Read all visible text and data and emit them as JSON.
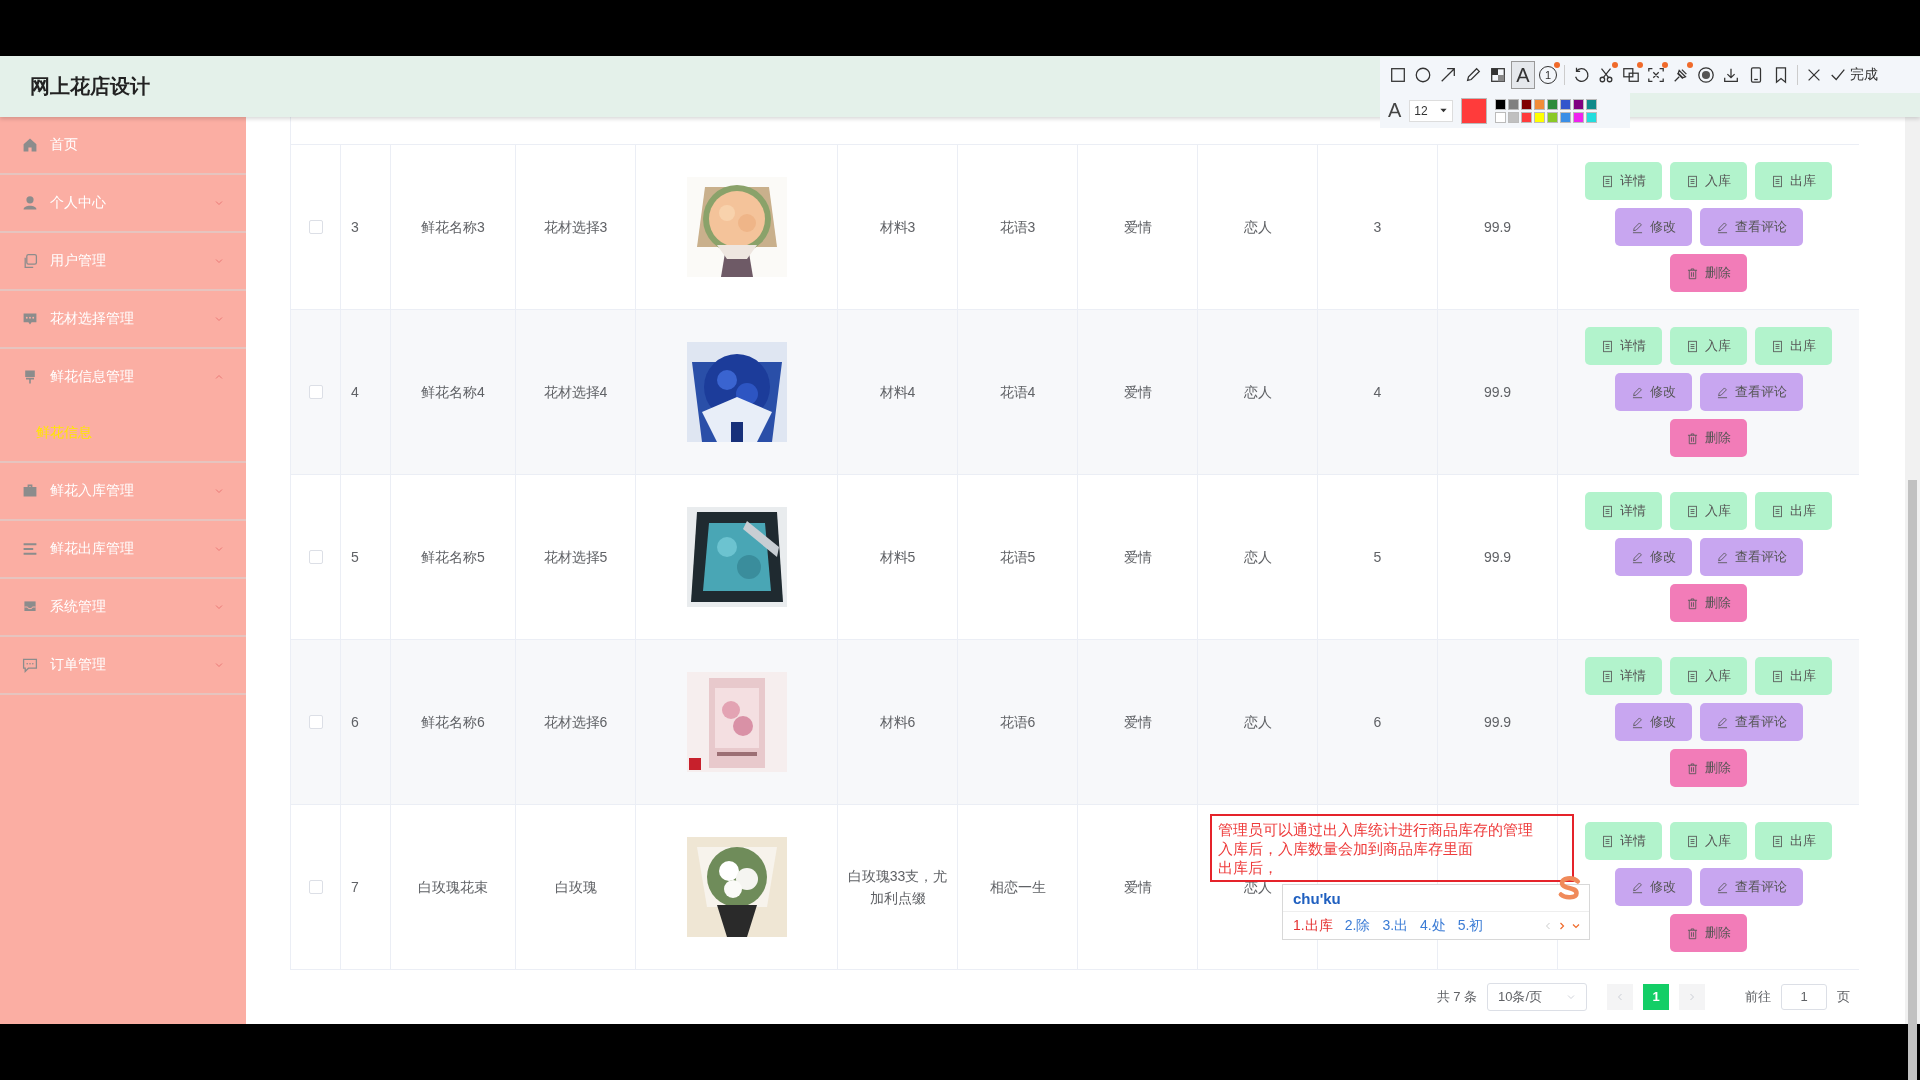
{
  "header": {
    "title": "网上花店设计"
  },
  "toolbar": {
    "tools": [
      {
        "kind": "rect",
        "selected": false
      },
      {
        "kind": "circle",
        "selected": false
      },
      {
        "kind": "arrow",
        "selected": false
      },
      {
        "kind": "pencil",
        "selected": false
      },
      {
        "kind": "mosaic",
        "selected": false
      },
      {
        "kind": "text",
        "label": "A",
        "selected": true
      },
      {
        "kind": "number",
        "label": "1",
        "selected": false,
        "badge": true
      },
      {
        "kind": "separator"
      },
      {
        "kind": "undo",
        "selected": false
      },
      {
        "kind": "cut",
        "selected": false,
        "badge": true
      },
      {
        "kind": "translate",
        "selected": false,
        "badge": true
      },
      {
        "kind": "ocr",
        "selected": false,
        "badge": true
      },
      {
        "kind": "pin",
        "selected": false,
        "badge": true
      },
      {
        "kind": "record",
        "selected": false
      },
      {
        "kind": "download",
        "selected": false
      },
      {
        "kind": "phone",
        "selected": false
      },
      {
        "kind": "bookmark",
        "selected": false
      },
      {
        "kind": "separator"
      },
      {
        "kind": "close",
        "selected": false
      },
      {
        "kind": "done",
        "label": "完成",
        "selected": false
      }
    ],
    "font_label": "A",
    "font_size": "12",
    "current_swatch": {
      "color": "#ff3b3b"
    },
    "swatches": [
      {
        "color": "#000000"
      },
      {
        "color": "#808080"
      },
      {
        "color": "#800000"
      },
      {
        "color": "#f28c38"
      },
      {
        "color": "#2e8b3a"
      },
      {
        "color": "#3355cc"
      },
      {
        "color": "#800080"
      },
      {
        "color": "#108a8a"
      },
      {
        "color": "#ffffff"
      },
      {
        "color": "#c0c0c0"
      },
      {
        "color": "#ff3b3b"
      },
      {
        "color": "#ffff00"
      },
      {
        "color": "#8ac926"
      },
      {
        "color": "#3a8ee6"
      },
      {
        "color": "#ee22ee"
      },
      {
        "color": "#22dddd"
      }
    ]
  },
  "sidebar": {
    "items": [
      {
        "label": "首页",
        "kind": "home"
      },
      {
        "label": "个人中心",
        "kind": "user",
        "expanded": false
      },
      {
        "label": "用户管理",
        "kind": "copy",
        "expanded": false
      },
      {
        "label": "花材选择管理",
        "kind": "chat",
        "expanded": false
      },
      {
        "label": "鲜花信息管理",
        "kind": "brush",
        "expanded": true,
        "children": [
          {
            "label": "鲜花信息",
            "selected": true
          }
        ]
      },
      {
        "label": "鲜花入库管理",
        "kind": "briefcase",
        "expanded": false
      },
      {
        "label": "鲜花出库管理",
        "kind": "list",
        "expanded": false
      },
      {
        "label": "系统管理",
        "kind": "inbox",
        "expanded": false
      },
      {
        "label": "订单管理",
        "kind": "message",
        "expanded": false
      }
    ]
  },
  "table": {
    "rows": [
      {
        "checked": false,
        "cells_before": [
          "3",
          "鲜花名称3",
          "花材选择3"
        ],
        "picture": {
          "kind": "picture"
        },
        "cells_after": [
          "材料3",
          "花语3",
          "爱情",
          "恋人",
          "3",
          "99.9"
        ],
        "actions": [
          [
            {
              "kind": "detail",
              "label": "详情"
            },
            {
              "kind": "stock_in",
              "label": "入库"
            },
            {
              "kind": "stock_out",
              "label": "出库"
            }
          ],
          [
            {
              "kind": "edit",
              "label": "修改"
            },
            {
              "kind": "review",
              "label": "查看评论"
            }
          ],
          [
            {
              "kind": "delete",
              "label": "删除"
            }
          ]
        ]
      },
      {
        "checked": false,
        "cells_before": [
          "4",
          "鲜花名称4",
          "花材选择4"
        ],
        "picture": {
          "kind": "picture"
        },
        "cells_after": [
          "材料4",
          "花语4",
          "爱情",
          "恋人",
          "4",
          "99.9"
        ],
        "actions": [
          [
            {
              "kind": "detail",
              "label": "详情"
            },
            {
              "kind": "stock_in",
              "label": "入库"
            },
            {
              "kind": "stock_out",
              "label": "出库"
            }
          ],
          [
            {
              "kind": "edit",
              "label": "修改"
            },
            {
              "kind": "review",
              "label": "查看评论"
            }
          ],
          [
            {
              "kind": "delete",
              "label": "删除"
            }
          ]
        ]
      },
      {
        "checked": false,
        "cells_before": [
          "5",
          "鲜花名称5",
          "花材选择5"
        ],
        "picture": {
          "kind": "picture"
        },
        "cells_after": [
          "材料5",
          "花语5",
          "爱情",
          "恋人",
          "5",
          "99.9"
        ],
        "actions": [
          [
            {
              "kind": "detail",
              "label": "详情"
            },
            {
              "kind": "stock_in",
              "label": "入库"
            },
            {
              "kind": "stock_out",
              "label": "出库"
            }
          ],
          [
            {
              "kind": "edit",
              "label": "修改"
            },
            {
              "kind": "review",
              "label": "查看评论"
            }
          ],
          [
            {
              "kind": "delete",
              "label": "删除"
            }
          ]
        ]
      },
      {
        "checked": false,
        "cells_before": [
          "6",
          "鲜花名称6",
          "花材选择6"
        ],
        "picture": {
          "kind": "picture"
        },
        "cells_after": [
          "材料6",
          "花语6",
          "爱情",
          "恋人",
          "6",
          "99.9"
        ],
        "actions": [
          [
            {
              "kind": "detail",
              "label": "详情"
            },
            {
              "kind": "stock_in",
              "label": "入库"
            },
            {
              "kind": "stock_out",
              "label": "出库"
            }
          ],
          [
            {
              "kind": "edit",
              "label": "修改"
            },
            {
              "kind": "review",
              "label": "查看评论"
            }
          ],
          [
            {
              "kind": "delete",
              "label": "删除"
            }
          ]
        ]
      },
      {
        "checked": false,
        "cells_before": [
          "7",
          "白玫瑰花束",
          "白玫瑰"
        ],
        "picture": {
          "kind": "picture"
        },
        "cells_after": [
          "白玫瑰33支，尤加利点缀",
          "相恋一生",
          "爱情",
          "恋人"
        ],
        "actions": [
          [
            {
              "kind": "detail",
              "label": "详情"
            },
            {
              "kind": "stock_in",
              "label": "入库"
            },
            {
              "kind": "stock_out",
              "label": "出库"
            }
          ],
          [
            {
              "kind": "edit",
              "label": "修改"
            },
            {
              "kind": "review",
              "label": "查看评论"
            }
          ],
          [
            {
              "kind": "delete",
              "label": "删除"
            }
          ]
        ]
      }
    ]
  },
  "pagination": {
    "total": "共 7 条",
    "page_size": "10条/页",
    "pages": [
      {
        "label": "1",
        "selected": true
      }
    ],
    "goto_label": "前往",
    "goto_value": "1",
    "goto_suffix": "页"
  },
  "annotation": {
    "lines": [
      "管理员可以通过出入库统计进行商品库存的管理",
      "入库后，入库数量会加到商品库存里面",
      "出库后，"
    ]
  },
  "ime": {
    "input": "chu'ku",
    "candidates": [
      {
        "label": "1.出库",
        "selected": true
      },
      {
        "label": "2.除",
        "selected": false
      },
      {
        "label": "3.出",
        "selected": false
      },
      {
        "label": "4.处",
        "selected": false
      },
      {
        "label": "5.初",
        "selected": false
      }
    ]
  }
}
